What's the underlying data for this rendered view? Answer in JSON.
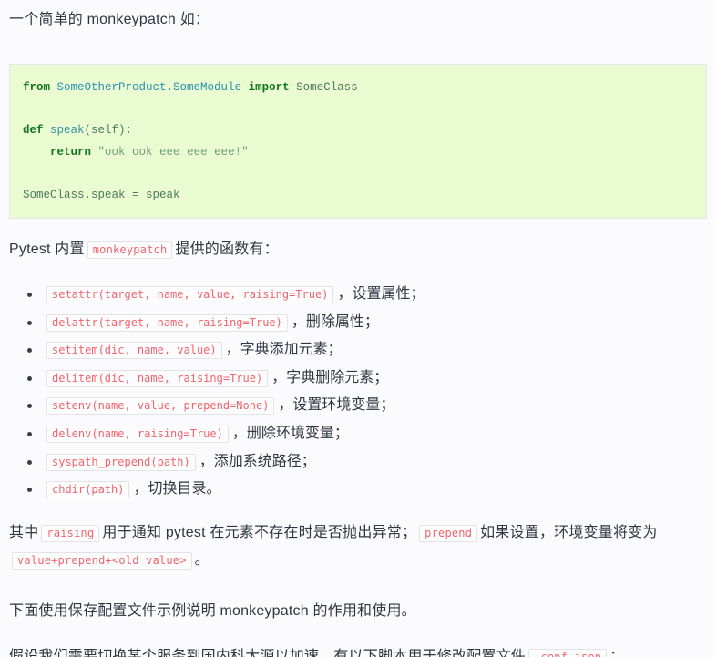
{
  "colors": {
    "page_bg": "#fbfbfd",
    "text": "#2f3640",
    "code_block_bg": "#eafbd2",
    "code_block_border": "#e6e6e6",
    "inline_code_text": "#f2636e",
    "inline_code_border": "#e3e3e3",
    "keyword": "#127620",
    "module": "#2b91af",
    "string": "#6f9c7d",
    "bullet": "#3a3f47"
  },
  "intro": {
    "text": "一个简单的 monkeypatch 如："
  },
  "code_block": {
    "language": "python",
    "lines": [
      {
        "tokens": [
          {
            "kind": "keyword",
            "text": "from"
          },
          {
            "kind": "space",
            "text": " "
          },
          {
            "kind": "module",
            "text": "SomeOtherProduct.SomeModule"
          },
          {
            "kind": "space",
            "text": " "
          },
          {
            "kind": "keyword",
            "text": "import"
          },
          {
            "kind": "space",
            "text": " "
          },
          {
            "kind": "name",
            "text": "SomeClass"
          }
        ]
      },
      {
        "tokens": []
      },
      {
        "tokens": [
          {
            "kind": "keyword",
            "text": "def"
          },
          {
            "kind": "space",
            "text": " "
          },
          {
            "kind": "fn",
            "text": "speak"
          },
          {
            "kind": "plain",
            "text": "(self):"
          }
        ]
      },
      {
        "tokens": [
          {
            "kind": "space",
            "text": "    "
          },
          {
            "kind": "keyword",
            "text": "return"
          },
          {
            "kind": "space",
            "text": " "
          },
          {
            "kind": "string",
            "text": "\"ook ook eee eee eee!\""
          }
        ]
      },
      {
        "tokens": []
      },
      {
        "tokens": [
          {
            "kind": "plain",
            "text": "SomeClass.speak = speak"
          }
        ]
      }
    ]
  },
  "pytest_builtin": {
    "before": "Pytest 内置",
    "code": "monkeypatch",
    "after": "提供的函数有："
  },
  "function_list": [
    {
      "code": "setattr(target, name, value, raising=True)",
      "desc": "，设置属性；"
    },
    {
      "code": "delattr(target, name, raising=True)",
      "desc": "，删除属性；"
    },
    {
      "code": "setitem(dic, name, value)",
      "desc": "，字典添加元素；"
    },
    {
      "code": "delitem(dic, name, raising=True)",
      "desc": "，字典删除元素；"
    },
    {
      "code": "setenv(name, value, prepend=None)",
      "desc": "，设置环境变量；"
    },
    {
      "code": "delenv(name, raising=True)",
      "desc": "，删除环境变量；"
    },
    {
      "code": "syspath_prepend(path)",
      "desc": "，添加系统路径；"
    },
    {
      "code": "chdir(path)",
      "desc": "，切换目录。"
    }
  ],
  "raising_para": {
    "seg1": "其中",
    "code1": "raising",
    "seg2": "用于通知 pytest 在元素不存在时是否抛出异常；",
    "code2": "prepend",
    "seg3": "如果设置，环境变量将变为",
    "code3": "value+prepend+<old value>",
    "seg4": "。"
  },
  "below_para": {
    "text": "下面使用保存配置文件示例说明 monkeypatch 的作用和使用。"
  },
  "assume_para": {
    "seg1": "假设我们需要切换某个服务到国内科大源以加速，有以下脚本用于修改配置文件",
    "code1": ".conf.json",
    "seg2": "："
  }
}
